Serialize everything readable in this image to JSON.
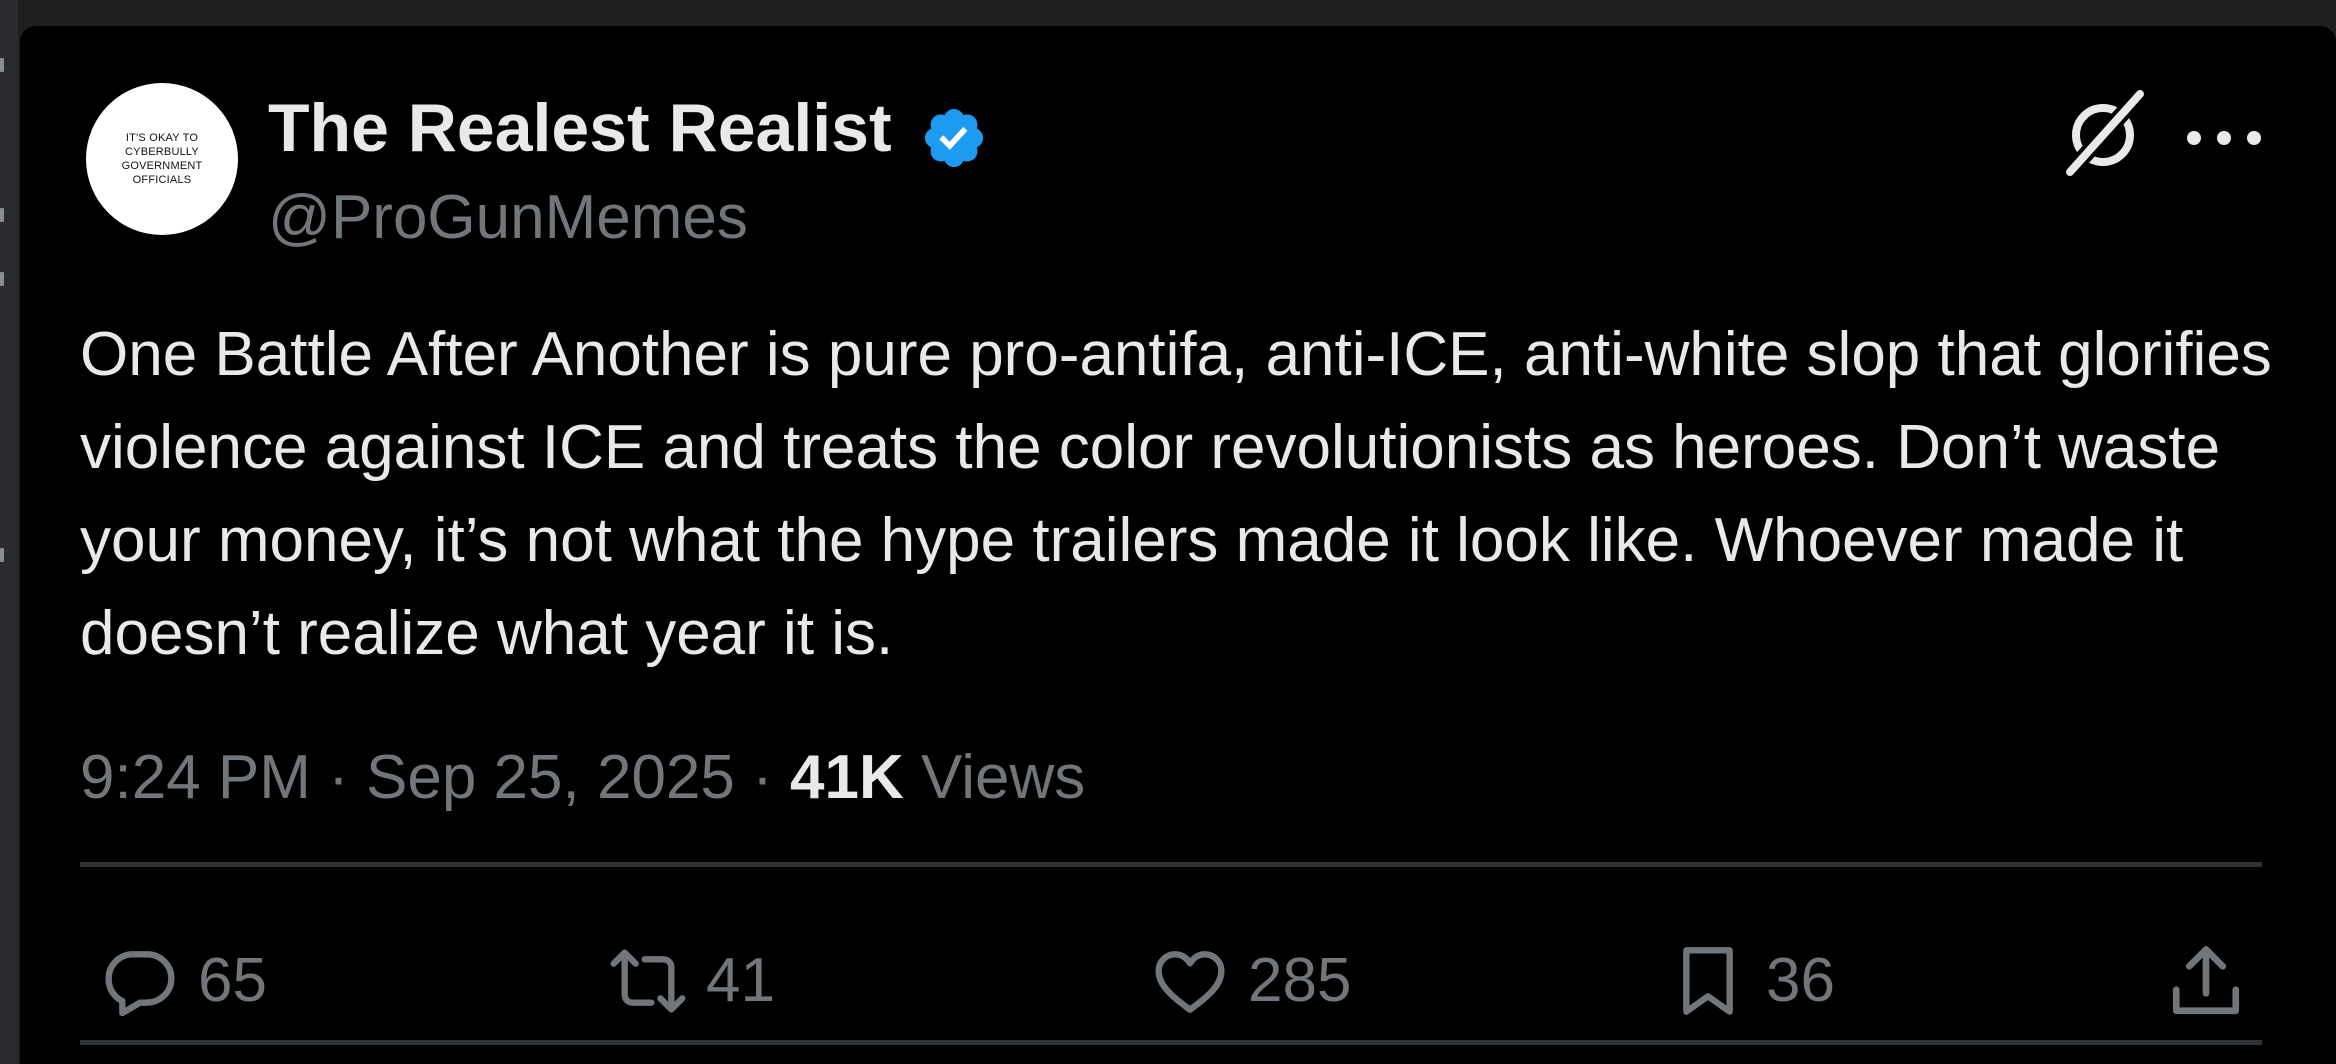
{
  "colors": {
    "background": "#000000",
    "text_primary": "#e7e9ea",
    "text_secondary": "#71767b",
    "verified_blue": "#1d9bf0",
    "divider": "#2f3336"
  },
  "author": {
    "avatar_text": "IT'S OKAY TO CYBERBULLY GOVERNMENT OFFICIALS",
    "name": "The Realest Realist",
    "handle": "@ProGunMemes",
    "verified_icon": "verified-badge-icon"
  },
  "header_icons": {
    "grok": "grok-icon",
    "more": "more-options-icon"
  },
  "tweet": {
    "text": "One Battle After Another is pure pro-antifa, anti-ICE, anti-white slop that glorifies violence against ICE and treats the color revolutionists as heroes. Don’t waste your money, it’s not what the hype trailers made it look like. Whoever made it doesn’t realize what year it is."
  },
  "meta": {
    "time": "9:24 PM",
    "separator": " · ",
    "date": "Sep 25, 2025",
    "views_count": "41K",
    "views_label": " Views"
  },
  "actions": {
    "replies": {
      "icon": "reply-icon",
      "count": "65"
    },
    "reposts": {
      "icon": "repost-icon",
      "count": "41"
    },
    "likes": {
      "icon": "heart-icon",
      "count": "285"
    },
    "bookmarks": {
      "icon": "bookmark-icon",
      "count": "36"
    },
    "share": {
      "icon": "share-icon"
    }
  }
}
